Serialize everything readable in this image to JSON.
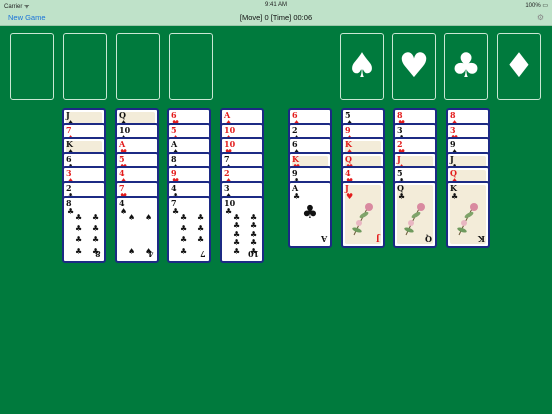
{
  "status_bar": {
    "carrier": "Carrier ᯤ",
    "time": "9:41 AM",
    "battery": "100% ▭"
  },
  "nav": {
    "new_game": "New Game",
    "status": "[Move] 0   [Time] 00:06",
    "gear_icon": "gear-icon"
  },
  "foundations": [
    {
      "suit": "♠",
      "icon": "spade-icon"
    },
    {
      "suit": "♥",
      "icon": "heart-icon"
    },
    {
      "suit": "♣",
      "icon": "club-icon"
    },
    {
      "suit": "♦",
      "icon": "diamond-icon"
    }
  ],
  "colors": {
    "felt": "#007a3d",
    "card_border": "#1c2a84",
    "red": "#e31c1c",
    "black": "#111111"
  },
  "tableau": [
    {
      "cards": [
        {
          "rank": "J",
          "suit": "♠",
          "color": "black"
        },
        {
          "rank": "7",
          "suit": "♦",
          "color": "red"
        },
        {
          "rank": "K",
          "suit": "♠",
          "color": "black"
        },
        {
          "rank": "6",
          "suit": "♣",
          "color": "black"
        },
        {
          "rank": "3",
          "suit": "♦",
          "color": "red"
        },
        {
          "rank": "2",
          "suit": "♣",
          "color": "black"
        },
        {
          "rank": "8",
          "suit": "♣",
          "color": "black",
          "face_up_full": true
        }
      ]
    },
    {
      "cards": [
        {
          "rank": "Q",
          "suit": "♠",
          "color": "black"
        },
        {
          "rank": "10",
          "suit": "♠",
          "color": "black"
        },
        {
          "rank": "A",
          "suit": "♥",
          "color": "red"
        },
        {
          "rank": "5",
          "suit": "♥",
          "color": "red"
        },
        {
          "rank": "4",
          "suit": "♦",
          "color": "red"
        },
        {
          "rank": "7",
          "suit": "♥",
          "color": "red"
        },
        {
          "rank": "4",
          "suit": "♠",
          "color": "black",
          "face_up_full": true
        }
      ]
    },
    {
      "cards": [
        {
          "rank": "6",
          "suit": "♥",
          "color": "red"
        },
        {
          "rank": "5",
          "suit": "♦",
          "color": "red"
        },
        {
          "rank": "A",
          "suit": "♠",
          "color": "black"
        },
        {
          "rank": "8",
          "suit": "♠",
          "color": "black"
        },
        {
          "rank": "9",
          "suit": "♥",
          "color": "red"
        },
        {
          "rank": "4",
          "suit": "♣",
          "color": "black"
        },
        {
          "rank": "7",
          "suit": "♣",
          "color": "black",
          "face_up_full": true
        }
      ]
    },
    {
      "cards": [
        {
          "rank": "A",
          "suit": "♦",
          "color": "red"
        },
        {
          "rank": "10",
          "suit": "♦",
          "color": "red"
        },
        {
          "rank": "10",
          "suit": "♥",
          "color": "red"
        },
        {
          "rank": "7",
          "suit": "♠",
          "color": "black"
        },
        {
          "rank": "2",
          "suit": "♦",
          "color": "red"
        },
        {
          "rank": "3",
          "suit": "♠",
          "color": "black"
        },
        {
          "rank": "10",
          "suit": "♣",
          "color": "black",
          "face_up_full": true
        }
      ]
    },
    {
      "cards": [
        {
          "rank": "6",
          "suit": "♦",
          "color": "red"
        },
        {
          "rank": "2",
          "suit": "♠",
          "color": "black"
        },
        {
          "rank": "6",
          "suit": "♠",
          "color": "black"
        },
        {
          "rank": "K",
          "suit": "♥",
          "color": "red"
        },
        {
          "rank": "9",
          "suit": "♣",
          "color": "black"
        },
        {
          "rank": "A",
          "suit": "♣",
          "color": "black",
          "face_up_full": true
        }
      ]
    },
    {
      "cards": [
        {
          "rank": "5",
          "suit": "♠",
          "color": "black"
        },
        {
          "rank": "9",
          "suit": "♦",
          "color": "red"
        },
        {
          "rank": "K",
          "suit": "♦",
          "color": "red"
        },
        {
          "rank": "Q",
          "suit": "♥",
          "color": "red"
        },
        {
          "rank": "4",
          "suit": "♥",
          "color": "red"
        },
        {
          "rank": "J",
          "suit": "♥",
          "color": "red",
          "face_up_full": true
        }
      ]
    },
    {
      "cards": [
        {
          "rank": "8",
          "suit": "♥",
          "color": "red"
        },
        {
          "rank": "3",
          "suit": "♣",
          "color": "black"
        },
        {
          "rank": "2",
          "suit": "♥",
          "color": "red"
        },
        {
          "rank": "J",
          "suit": "♦",
          "color": "red"
        },
        {
          "rank": "5",
          "suit": "♣",
          "color": "black"
        },
        {
          "rank": "Q",
          "suit": "♣",
          "color": "black",
          "face_up_full": true
        }
      ]
    },
    {
      "cards": [
        {
          "rank": "8",
          "suit": "♦",
          "color": "red"
        },
        {
          "rank": "3",
          "suit": "♥",
          "color": "red"
        },
        {
          "rank": "9",
          "suit": "♠",
          "color": "black"
        },
        {
          "rank": "J",
          "suit": "♣",
          "color": "black"
        },
        {
          "rank": "Q",
          "suit": "♦",
          "color": "red"
        },
        {
          "rank": "K",
          "suit": "♣",
          "color": "black",
          "face_up_full": true
        }
      ]
    }
  ]
}
